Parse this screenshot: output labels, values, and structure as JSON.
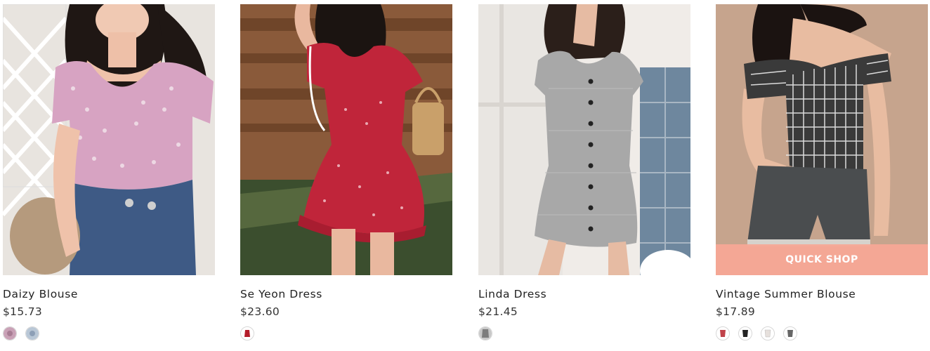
{
  "products": [
    {
      "name": "Daizy Blouse",
      "price": "$15.73",
      "swatches": [
        {
          "name": "pink-floral",
          "color": "#c9a1b6"
        },
        {
          "name": "blue-floral",
          "color": "#b9c7d6"
        }
      ]
    },
    {
      "name": "Se Yeon Dress",
      "price": "$23.60",
      "swatches": [
        {
          "name": "red-dot",
          "color": "#b41c2a"
        }
      ]
    },
    {
      "name": "Linda Dress",
      "price": "$21.45",
      "swatches": [
        {
          "name": "gray-gingham",
          "color": "#7d7d7d"
        }
      ]
    },
    {
      "name": "Vintage Summer Blouse",
      "price": "$17.89",
      "quick_shop_label": "QUICK SHOP",
      "swatches": [
        {
          "name": "red",
          "color": "#c0424a"
        },
        {
          "name": "black",
          "color": "#222222"
        },
        {
          "name": "white",
          "color": "#e6e0dc"
        },
        {
          "name": "gingham",
          "color": "#666666"
        }
      ]
    }
  ],
  "colors": {
    "quick_shop_bg": "#f7a896",
    "text": "#222222"
  }
}
